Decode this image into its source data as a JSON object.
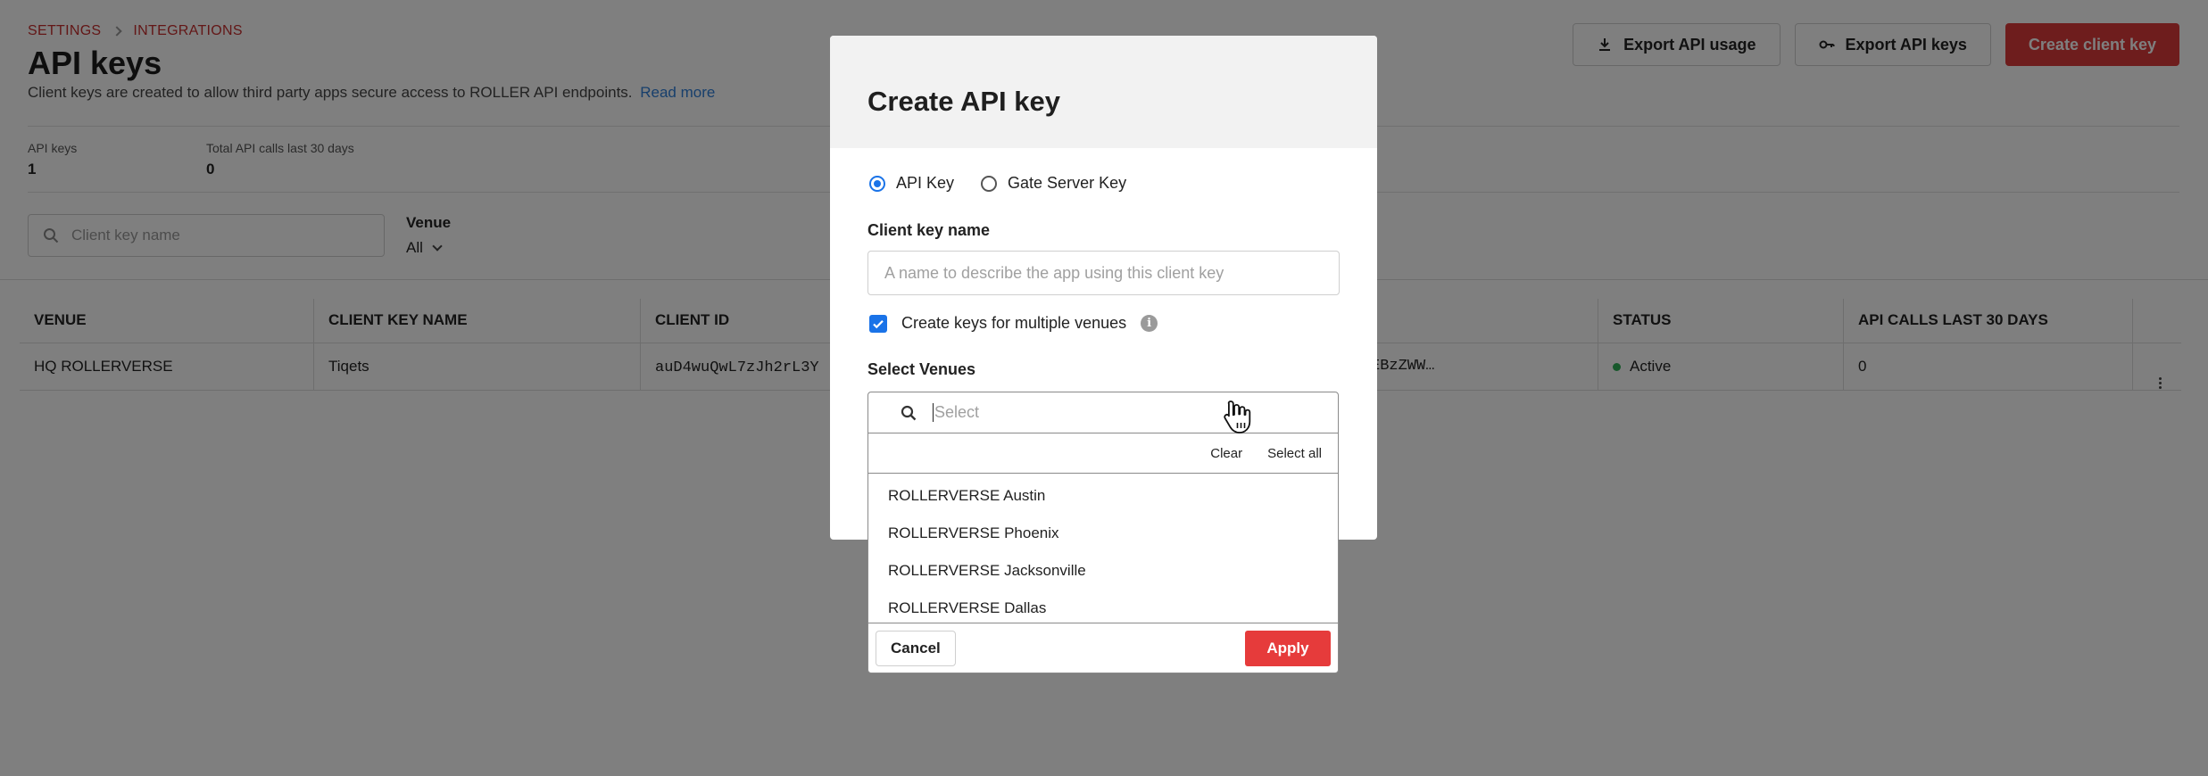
{
  "breadcrumb": {
    "settings": "SETTINGS",
    "integrations": "INTEGRATIONS"
  },
  "page": {
    "title": "API keys",
    "subtitle": "Client keys are created to allow third party apps secure access to ROLLER API endpoints.",
    "read_more": "Read more"
  },
  "actions": {
    "export_usage": "Export API usage",
    "export_keys": "Export API keys",
    "create_client_key": "Create client key"
  },
  "stats": {
    "api_keys_label": "API keys",
    "api_keys_value": "1",
    "calls_label": "Total API calls last 30 days",
    "calls_value": "0"
  },
  "filters": {
    "search_placeholder": "Client key name",
    "venue_label": "Venue",
    "venue_value": "All"
  },
  "table": {
    "headers": [
      "VENUE",
      "CLIENT KEY NAME",
      "CLIENT ID",
      "",
      "STATUS",
      "API CALLS LAST 30 DAYS"
    ],
    "rows": [
      {
        "venue": "HQ ROLLERVERSE",
        "name": "Tiqets",
        "client_id": "auD4wuQwL7zJh2rL3Y",
        "secret": "EBzZWW…",
        "status": "Active",
        "calls": "0"
      }
    ]
  },
  "modal": {
    "title": "Create API key",
    "radio_api_key": "API Key",
    "radio_gate_key": "Gate Server Key",
    "selected_radio": "API Key",
    "client_key_label": "Client key name",
    "client_key_placeholder": "A name to describe the app using this client key",
    "multi_venue_label": "Create keys for multiple venues",
    "multi_venue_checked": true,
    "select_venues_label": "Select Venues"
  },
  "dropdown": {
    "search_placeholder": "Select",
    "clear": "Clear",
    "select_all": "Select all",
    "options": [
      "ROLLERVERSE Austin",
      "ROLLERVERSE Phoenix",
      "ROLLERVERSE Jacksonville",
      "ROLLERVERSE Dallas"
    ],
    "cancel": "Cancel",
    "apply": "Apply"
  },
  "colors": {
    "brand_red": "#dc3a3a",
    "accent_blue": "#1a73e8",
    "status_green": "#2fb157",
    "link_blue": "#2f7fd8"
  }
}
